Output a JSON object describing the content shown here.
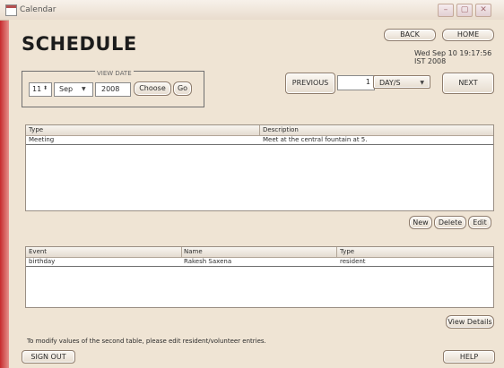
{
  "window": {
    "title": "Calendar",
    "controls": [
      "minimize",
      "maximize",
      "close"
    ]
  },
  "header": {
    "title": "SCHEDULE",
    "back_label": "BACK",
    "home_label": "HOME",
    "datetime": "Wed Sep 10 19:17:56 IST 2008"
  },
  "view_date": {
    "legend": "VIEW DATE",
    "day": "11",
    "month": "Sep",
    "year": "2008",
    "choose_label": "Choose",
    "go_label": "Go"
  },
  "navigation": {
    "previous_label": "PREVIOUS",
    "count": "1",
    "unit": "DAY/S",
    "next_label": "NEXT"
  },
  "schedule_table": {
    "columns": [
      "Type",
      "Description"
    ],
    "rows": [
      [
        "Meeting",
        "Meet at the central fountain at 5."
      ]
    ],
    "new_label": "New",
    "delete_label": "Delete",
    "edit_label": "Edit"
  },
  "event_table": {
    "columns": [
      "Event",
      "Name",
      "Type"
    ],
    "rows": [
      [
        "birthday",
        "Rakesh Saxena",
        "resident"
      ]
    ]
  },
  "footer": {
    "note": "To modify values of the second table, please edit resident/volunteer entries.",
    "view_details_label": "View Details",
    "sign_out_label": "SIGN OUT",
    "help_label": "HELP"
  }
}
